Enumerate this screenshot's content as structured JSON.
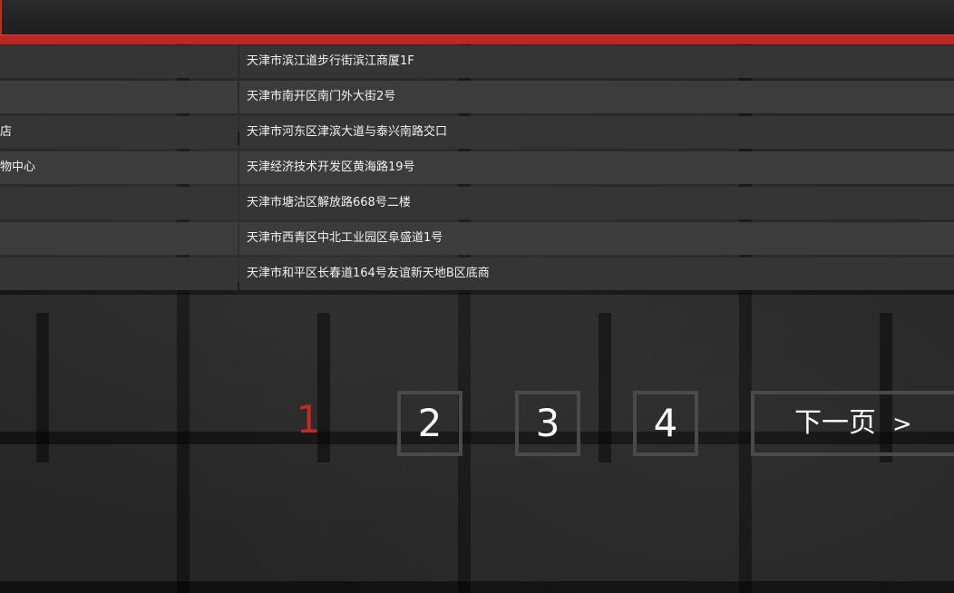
{
  "stores": [
    {
      "name": "",
      "address": "天津市滨江道步行街滨江商厦1F"
    },
    {
      "name": "",
      "address": "天津市南开区南门外大街2号"
    },
    {
      "name": "店",
      "address": "天津市河东区津滨大道与泰兴南路交口"
    },
    {
      "name": "物中心",
      "address": "天津经济技术开发区黄海路19号"
    },
    {
      "name": "",
      "address": "天津市塘沽区解放路668号二楼"
    },
    {
      "name": "",
      "address": "天津市西青区中北工业园区阜盛道1号"
    },
    {
      "name": "",
      "address": "天津市和平区长春道164号友谊新天地B区底商"
    }
  ],
  "pagination": {
    "pages": [
      "1",
      "2",
      "3",
      "4"
    ],
    "current": "1",
    "next_label": "下一页",
    "next_arrow": ">"
  },
  "colors": {
    "accent": "#c62828",
    "row_bg": "#353535",
    "page_border": "#4a4a4a"
  }
}
